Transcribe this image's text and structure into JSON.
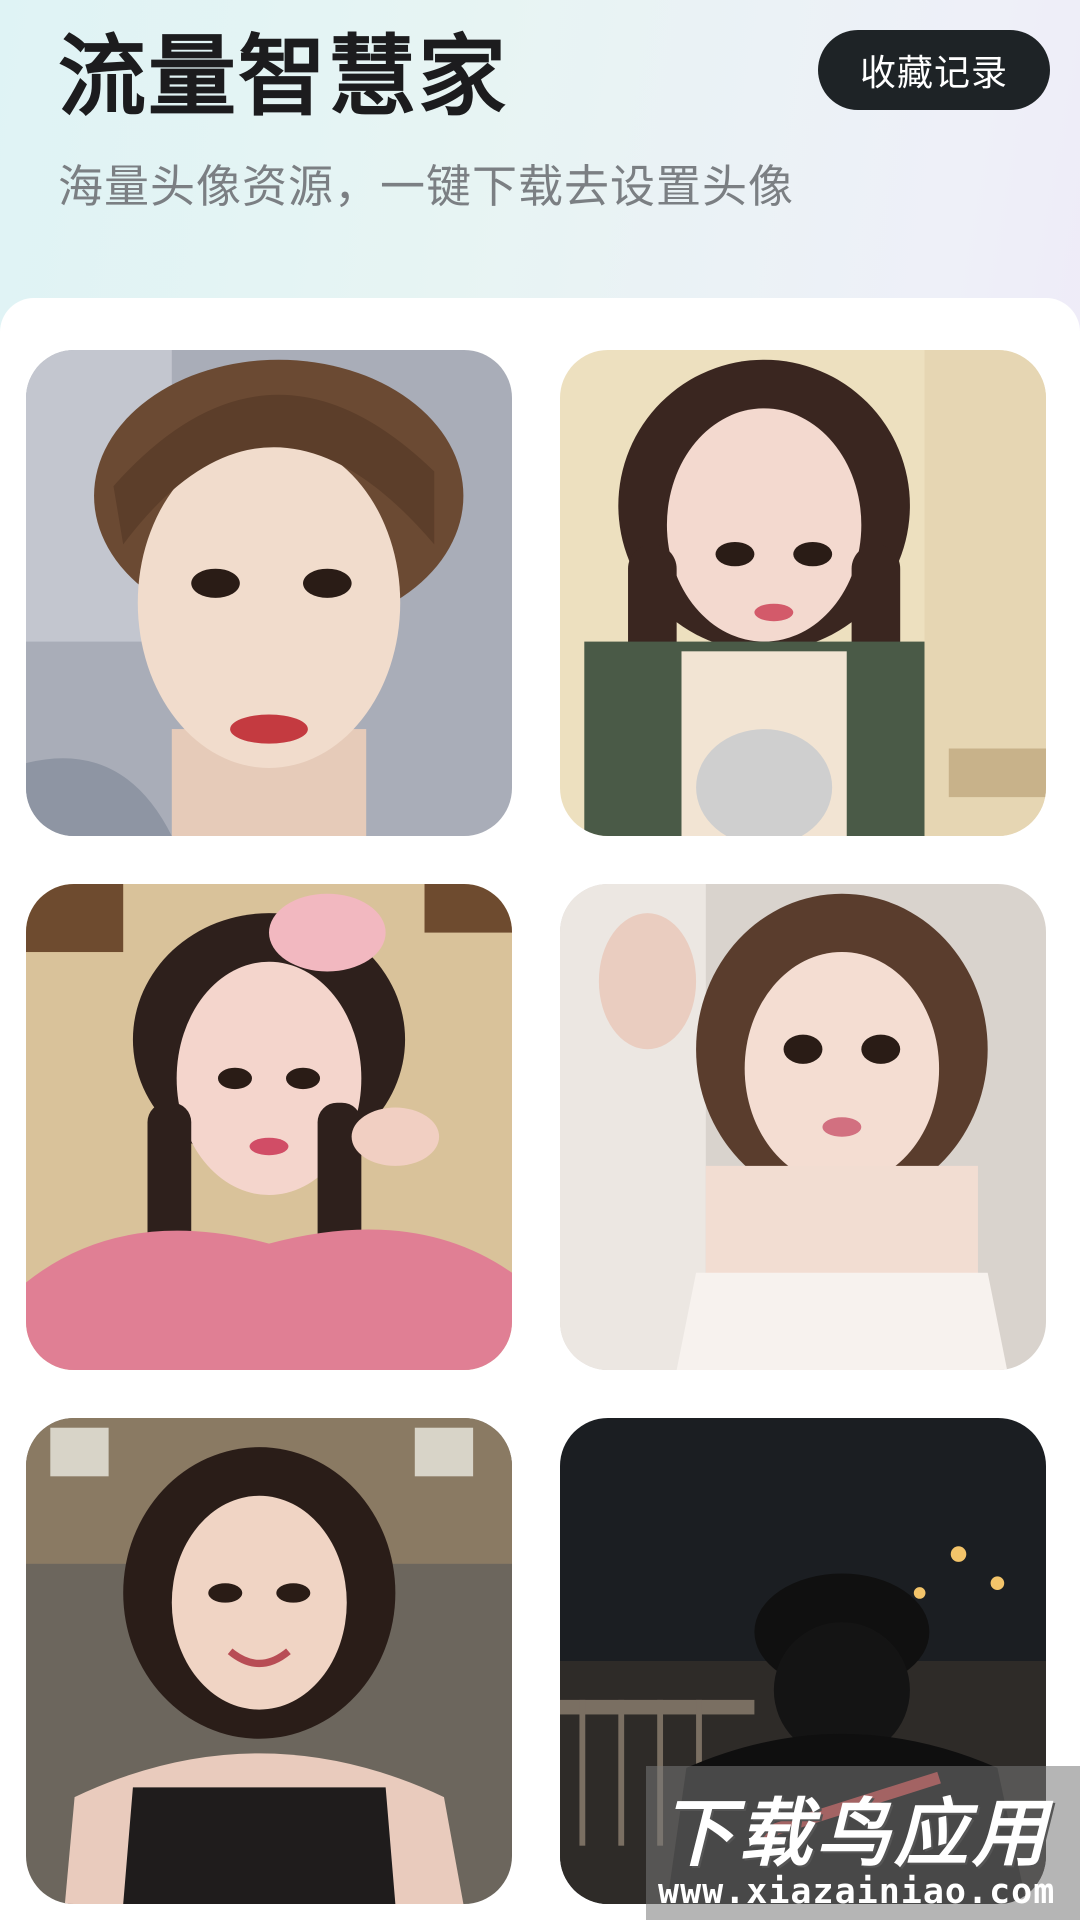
{
  "header": {
    "title": "流量智慧家",
    "subtitle": "海量头像资源，一键下载去设置头像",
    "favorites_label": "收藏记录"
  },
  "avatars": [
    {
      "label": "avatar-1"
    },
    {
      "label": "avatar-2"
    },
    {
      "label": "avatar-3"
    },
    {
      "label": "avatar-4"
    },
    {
      "label": "avatar-5"
    },
    {
      "label": "avatar-6"
    }
  ],
  "watermark": {
    "title": "下载鸟应用",
    "url": "www.xiazainiao.com"
  },
  "colors": {
    "accent_button": "#1e2326",
    "title_text": "#1c1c1e",
    "subtitle_text": "#7b7f83"
  }
}
